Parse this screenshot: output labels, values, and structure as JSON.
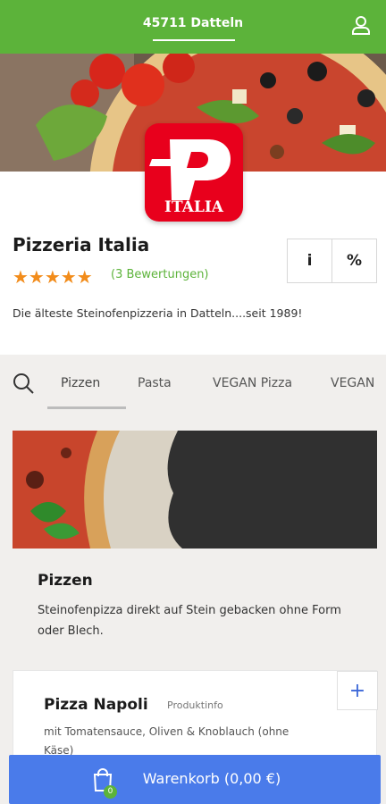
{
  "header": {
    "location": "45711 Datteln",
    "user_icon": "user-icon",
    "bg_color": "#5cb33a"
  },
  "restaurant": {
    "logo_text": "ITALIA",
    "name": "Pizzeria Italia",
    "rating": 5,
    "stars": "★★★★★",
    "reviews": "(3 Bewertungen)",
    "description": "Die älteste Steinofenpizzeria in Datteln....seit 1989!",
    "info_label": "i",
    "discount_label": "%"
  },
  "nav": {
    "search_icon": "search-icon",
    "tabs": [
      {
        "label": "Pizzen",
        "active": true
      },
      {
        "label": "Pasta",
        "active": false
      },
      {
        "label": "VEGAN Pizza",
        "active": false
      },
      {
        "label": "VEGAN",
        "active": false
      }
    ]
  },
  "category": {
    "title": "Pizzen",
    "description": "Steinofenpizza direkt auf Stein gebacken ohne Form oder Blech."
  },
  "products": [
    {
      "name": "Pizza Napoli",
      "info_link": "Produktinfo",
      "description": "mit Tomatensauce, Oliven & Knoblauch (ohne Käse)",
      "add_label": "+"
    }
  ],
  "cart": {
    "label": "Warenkorb (0,00 €)",
    "count": "0",
    "bg_color": "#4a7bea",
    "badge_color": "#5cb33a"
  }
}
